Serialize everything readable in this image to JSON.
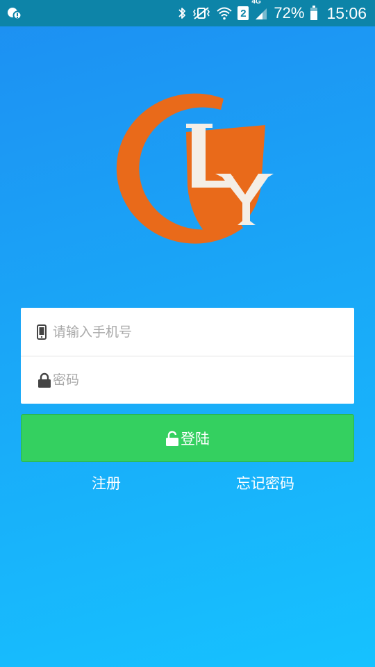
{
  "status_bar": {
    "battery_percent": "72%",
    "time": "15:06",
    "network": "4G",
    "sim_slot": "2",
    "battery_level": 0.72,
    "icons": [
      "notification-icon",
      "bluetooth-icon",
      "vibrate-icon",
      "wifi-icon",
      "sim-icon",
      "signal-icon",
      "battery-icon"
    ]
  },
  "logo": {
    "letters": "LY",
    "colors": {
      "orange": "#e96a1a"
    }
  },
  "form": {
    "phone": {
      "placeholder": "请输入手机号",
      "value": "",
      "icon": "phone-icon"
    },
    "password": {
      "placeholder": "密码",
      "value": "",
      "icon": "lock-icon"
    }
  },
  "login_button": {
    "label": "登陆",
    "icon": "unlock-icon"
  },
  "links": {
    "register": "注册",
    "forgot_password": "忘记密码"
  },
  "colors": {
    "background_top": "#1d8ff2",
    "background_bottom": "#16c2ff",
    "status_bar": "#0d84a8",
    "button": "#34d060"
  }
}
